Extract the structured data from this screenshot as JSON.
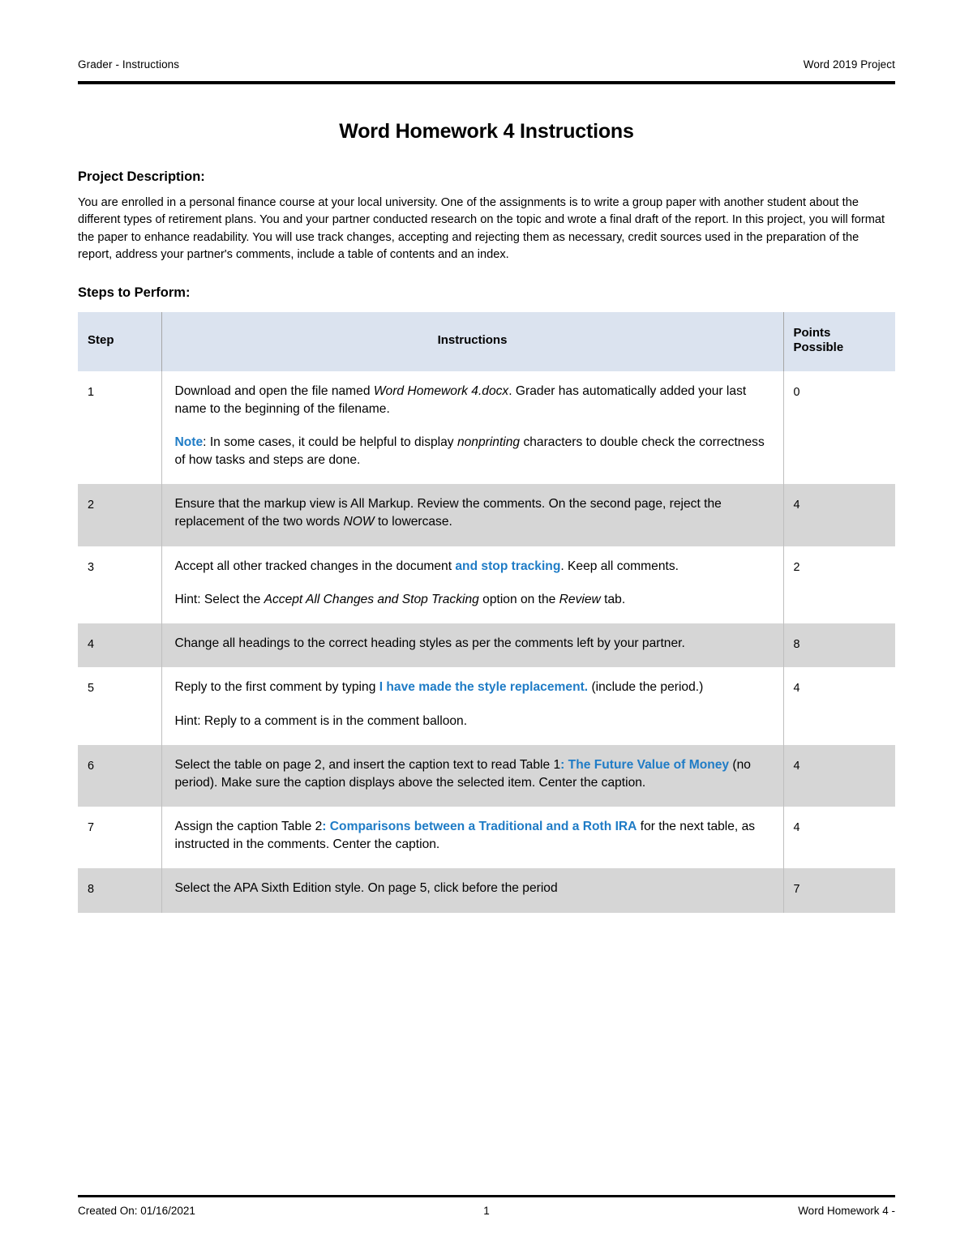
{
  "header": {
    "left": "Grader - Instructions",
    "right": "Word 2019 Project"
  },
  "title": "Word Homework 4 Instructions",
  "project_description": {
    "label": "Project Description:",
    "text": "You are enrolled in a personal finance course at your local university. One of the assignments is to write a group paper with another student about the different types of retirement plans. You and your partner conducted research on the topic and wrote a final draft of the report. In this project, you will format the paper to enhance readability. You will use track changes, accepting and rejecting them as necessary, credit sources used in the preparation of the report, address your partner's comments, include a table of contents and an index."
  },
  "steps_section": {
    "label": "Steps to Perform:"
  },
  "table": {
    "columns": {
      "step": "Step",
      "instructions": "Instructions",
      "points": "Points Possible",
      "points_line1": "Points",
      "points_line2": "Possible"
    },
    "rows": [
      {
        "step": "1",
        "points": "0",
        "shaded": false,
        "blocks": [
          {
            "parts": [
              {
                "t": "Download and open the file named ",
                "s": "normal"
              },
              {
                "t": "Word Homework 4.docx",
                "s": "italic"
              },
              {
                "t": ". Grader has automatically added your last name to the beginning of the filename.",
                "s": "normal"
              }
            ]
          },
          {
            "parts": [
              {
                "t": "Note",
                "s": "accent"
              },
              {
                "t": ": In some cases, it could be helpful to display ",
                "s": "normal"
              },
              {
                "t": "nonprinting",
                "s": "italic"
              },
              {
                "t": " characters to double check the correctness of how tasks and steps are done.",
                "s": "normal"
              }
            ]
          }
        ]
      },
      {
        "step": "2",
        "points": "4",
        "shaded": true,
        "blocks": [
          {
            "parts": [
              {
                "t": "Ensure that the markup view is All Markup. Review the comments. On the second page, reject the replacement of the two words ",
                "s": "normal"
              },
              {
                "t": "NOW",
                "s": "italic"
              },
              {
                "t": " to lowercase.",
                "s": "normal"
              }
            ]
          }
        ]
      },
      {
        "step": "3",
        "points": "2",
        "shaded": false,
        "blocks": [
          {
            "parts": [
              {
                "t": "Accept all other tracked changes in the document ",
                "s": "normal"
              },
              {
                "t": "and stop tracking",
                "s": "accent"
              },
              {
                "t": ". Keep all comments.",
                "s": "normal"
              }
            ]
          },
          {
            "tight": true,
            "parts": [
              {
                "t": "Hint: Select the ",
                "s": "normal"
              },
              {
                "t": "Accept All Changes and Stop Tracking",
                "s": "italic"
              },
              {
                "t": " option on the ",
                "s": "normal"
              },
              {
                "t": "Review",
                "s": "italic"
              },
              {
                "t": " tab.",
                "s": "normal"
              }
            ]
          }
        ]
      },
      {
        "step": "4",
        "points": "8",
        "shaded": true,
        "blocks": [
          {
            "parts": [
              {
                "t": "Change all headings to the correct heading styles as per the comments left by your partner.",
                "s": "normal"
              }
            ]
          }
        ]
      },
      {
        "step": "5",
        "points": "4",
        "shaded": false,
        "blocks": [
          {
            "parts": [
              {
                "t": "Reply to the first comment by typing ",
                "s": "normal"
              },
              {
                "t": "I have made the style replacement.",
                "s": "accent"
              },
              {
                "t": " (include the period.)",
                "s": "normal"
              }
            ]
          },
          {
            "parts": [
              {
                "t": "Hint: Reply to a comment is in the comment balloon.",
                "s": "normal"
              }
            ]
          }
        ]
      },
      {
        "step": "6",
        "points": "4",
        "shaded": true,
        "blocks": [
          {
            "parts": [
              {
                "t": "Select the table on page 2, and insert the caption text to read Table 1",
                "s": "normal"
              },
              {
                "t": ": The Future Value of Money",
                "s": "accent"
              },
              {
                "t": " (no period). Make sure the caption displays above the selected item. Center the caption.",
                "s": "normal"
              }
            ]
          }
        ]
      },
      {
        "step": "7",
        "points": "4",
        "shaded": false,
        "blocks": [
          {
            "parts": [
              {
                "t": "Assign the caption Table 2",
                "s": "normal"
              },
              {
                "t": ": Comparisons between a Traditional and a Roth IRA",
                "s": "accent"
              },
              {
                "t": " for the next table, as instructed in the comments. Center the caption.",
                "s": "normal"
              }
            ]
          }
        ]
      },
      {
        "step": "8",
        "points": "7",
        "shaded": true,
        "blocks": [
          {
            "parts": [
              {
                "t": "Select the APA Sixth Edition style. On page 5, click before the period",
                "s": "normal"
              }
            ]
          }
        ]
      }
    ]
  },
  "footer": {
    "created_on": "Created On: 01/16/2021",
    "page_number": "1",
    "doc_name": "Word Homework 4 -"
  },
  "colors": {
    "accent": "#1f7cc6",
    "header_row_bg": "#dbe3ef",
    "shaded_row_bg": "#d6d6d6"
  }
}
